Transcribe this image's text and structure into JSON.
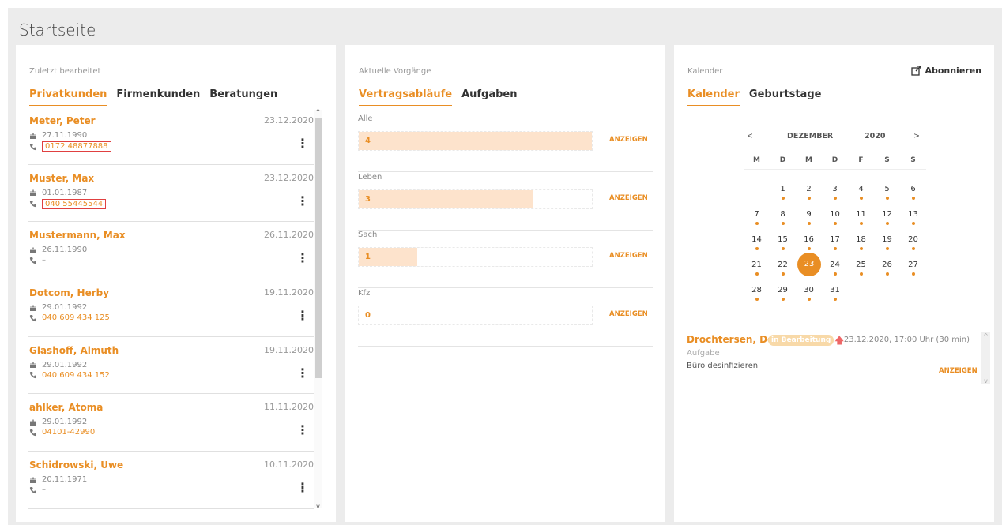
{
  "page": {
    "title": "Startseite"
  },
  "colors": {
    "accent": "#e98e24",
    "bar_fill": "#fde3cc",
    "badge": "#f8d9a8",
    "highlight_border": "#e04040"
  },
  "recent": {
    "title": "Zuletzt bearbeitet",
    "tabs": [
      "Privatkunden",
      "Firmenkunden",
      "Beratungen"
    ],
    "active_tab": "Privatkunden",
    "contacts": [
      {
        "name": "Meter, Peter",
        "date": "23.12.2020",
        "birthday": "27.11.1990",
        "phone": "0172 48877888",
        "highlighted": true
      },
      {
        "name": "Muster, Max",
        "date": "23.12.2020",
        "birthday": "01.01.1987",
        "phone": "040 55445544",
        "highlighted": true
      },
      {
        "name": "Mustermann, Max",
        "date": "26.11.2020",
        "birthday": "26.11.1990",
        "phone": "–",
        "highlighted": false
      },
      {
        "name": "Dotcom, Herby",
        "date": "19.11.2020",
        "birthday": "29.01.1992",
        "phone": "040 609 434 125",
        "highlighted": false
      },
      {
        "name": "Glashoff, Almuth",
        "date": "19.11.2020",
        "birthday": "29.01.1992",
        "phone": "040 609 434 152",
        "highlighted": false
      },
      {
        "name": "ahlker, Atoma",
        "date": "11.11.2020",
        "birthday": "29.01.1992",
        "phone": "04101-42990",
        "highlighted": false
      },
      {
        "name": "Schidrowski, Uwe",
        "date": "10.11.2020",
        "birthday": "20.11.1971",
        "phone": "–",
        "highlighted": false
      }
    ],
    "scroll_up": "^",
    "scroll_down": "v"
  },
  "vorgaenge": {
    "title": "Aktuelle Vorgänge",
    "tabs": [
      "Vertragsabläufe",
      "Aufgaben"
    ],
    "active_tab": "Vertragsabläufe",
    "link_label": "ANZEIGEN",
    "items": [
      {
        "label": "Alle",
        "count": "4",
        "fill": 1.0
      },
      {
        "label": "Leben",
        "count": "3",
        "fill": 0.75
      },
      {
        "label": "Sach",
        "count": "1",
        "fill": 0.25
      },
      {
        "label": "Kfz",
        "count": "0",
        "fill": 0.0
      }
    ]
  },
  "calendar": {
    "title": "Kalender",
    "subscribe_label": "Abonnieren",
    "subscribe_icon": "external-link-icon",
    "tabs": [
      "Kalender",
      "Geburtstage"
    ],
    "active_tab": "Kalender",
    "prev": "<",
    "next": ">",
    "month": "DEZEMBER",
    "year": "2020",
    "weekdays": [
      "M",
      "D",
      "M",
      "D",
      "F",
      "S",
      "S"
    ],
    "weeks": [
      [
        null,
        "1",
        "2",
        "3",
        "4",
        "5",
        "6"
      ],
      [
        "7",
        "8",
        "9",
        "10",
        "11",
        "12",
        "13"
      ],
      [
        "14",
        "15",
        "16",
        "17",
        "18",
        "19",
        "20"
      ],
      [
        "21",
        "22",
        "23",
        "24",
        "25",
        "26",
        "27"
      ],
      [
        "28",
        "29",
        "30",
        "31",
        null,
        null,
        null
      ]
    ],
    "today": "23",
    "event": {
      "name": "Drochtersen, Dora",
      "status": "in Bearbeitung",
      "priority_icon": "arrow-up-icon",
      "time": "23.12.2020, 17:00 Uhr (30 min)",
      "type": "Aufgabe",
      "description": "Büro desinfizieren",
      "link_label": "ANZEIGEN",
      "scroll_up": "^",
      "scroll_down": "v"
    }
  }
}
